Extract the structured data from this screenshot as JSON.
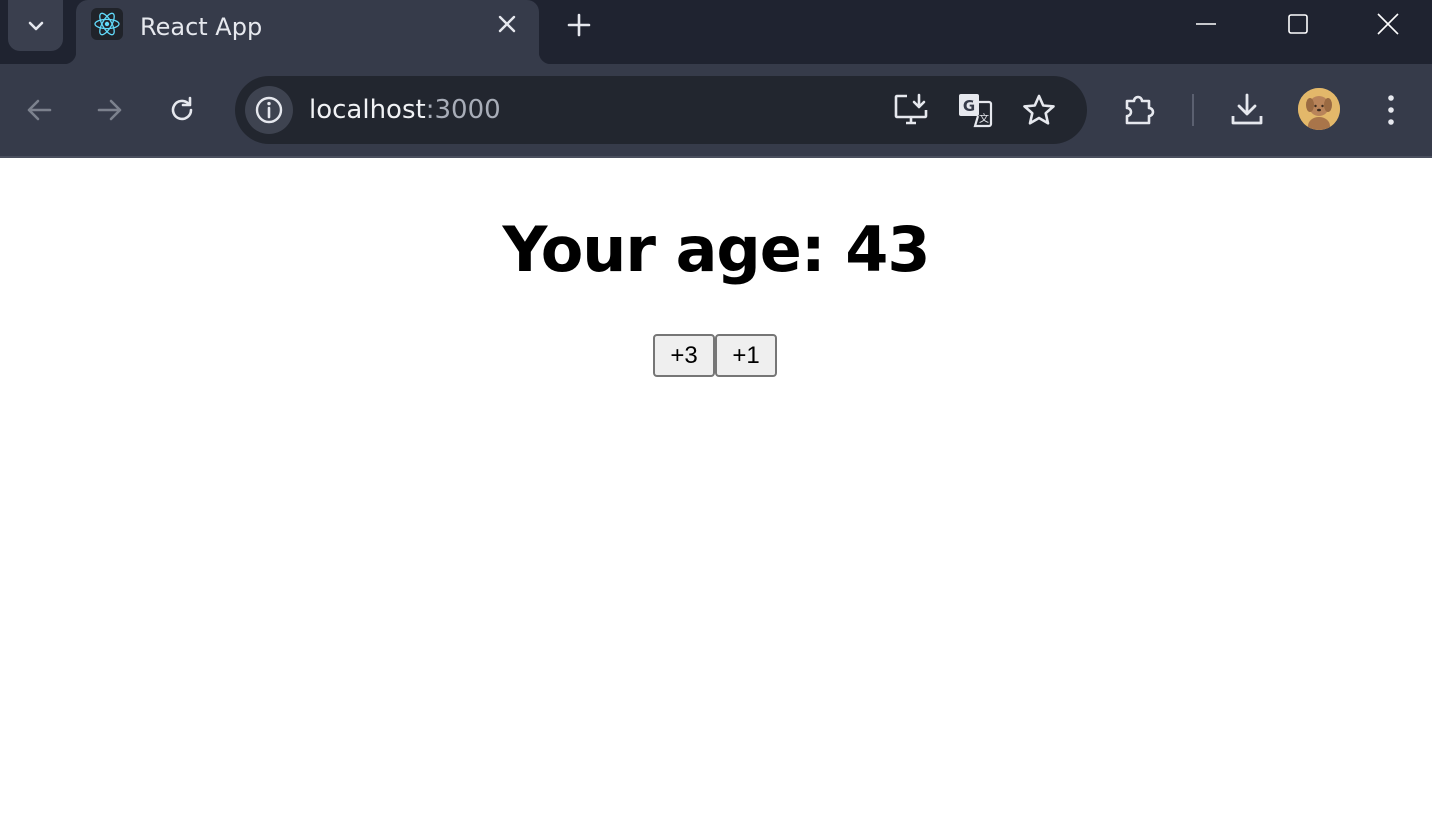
{
  "browser": {
    "tab": {
      "title": "React App",
      "favicon_icon": "react-logo-icon"
    },
    "address": {
      "host": "localhost",
      "port": ":3000"
    },
    "icons": {
      "tab_search": "chevron-down-icon",
      "tab_close": "close-icon",
      "new_tab": "plus-icon",
      "back": "arrow-left-icon",
      "forward": "arrow-right-icon",
      "reload": "reload-icon",
      "site_info": "info-icon",
      "install": "install-app-icon",
      "translate": "translate-icon",
      "bookmark": "star-icon",
      "extensions": "puzzle-icon",
      "downloads": "download-icon",
      "profile": "avatar",
      "menu": "kebab-menu-icon"
    },
    "colors": {
      "frame": "#1f2330",
      "toolbar": "#363b4a",
      "omnibox": "#22262f"
    }
  },
  "page": {
    "heading": "Your age: 43",
    "buttons": [
      {
        "label": "+3"
      },
      {
        "label": "+1"
      }
    ]
  }
}
